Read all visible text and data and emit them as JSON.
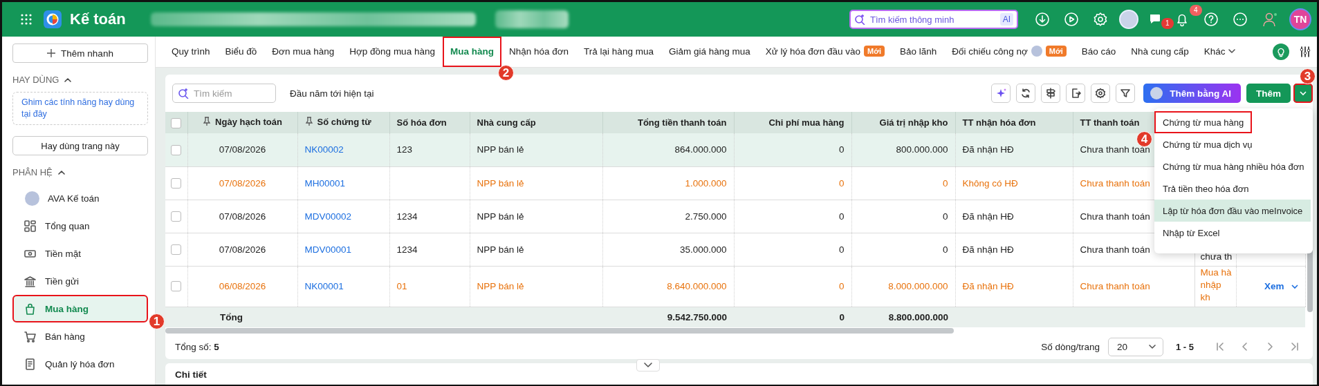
{
  "header": {
    "app_title": "Kế toán",
    "search": {
      "placeholder": "Tìm kiếm thông minh",
      "badge": "AI"
    },
    "message_count": "1",
    "notification_count": "4",
    "user_initials": "TN"
  },
  "sidebar": {
    "quick_add": "Thêm nhanh",
    "favorites": {
      "title": "HAY DÙNG",
      "expanded": true,
      "hint": "Ghim các tính năng hay dùng tại đây",
      "button": "Hay dùng trang này"
    },
    "modules": {
      "title": "PHÂN HỆ",
      "expanded": true,
      "items": [
        {
          "label": "AVA Kế toán",
          "selected": false
        },
        {
          "label": "Tổng quan",
          "selected": false
        },
        {
          "label": "Tiền mặt",
          "selected": false
        },
        {
          "label": "Tiền gửi",
          "selected": false
        },
        {
          "label": "Mua hàng",
          "selected": true,
          "callout": "1"
        },
        {
          "label": "Bán hàng",
          "selected": false
        },
        {
          "label": "Quản lý hóa đơn",
          "selected": false
        }
      ]
    }
  },
  "tabs": [
    {
      "label": "Quy trình",
      "selected": false
    },
    {
      "label": "Biểu đồ",
      "selected": false
    },
    {
      "label": "Đơn mua hàng",
      "selected": false
    },
    {
      "label": "Hợp đồng mua hàng",
      "selected": false
    },
    {
      "label": "Mua hàng",
      "selected": true,
      "callout": "2"
    },
    {
      "label": "Nhận hóa đơn",
      "selected": false
    },
    {
      "label": "Trả lại hàng mua",
      "selected": false
    },
    {
      "label": "Giảm giá hàng mua",
      "selected": false
    },
    {
      "label": "Xử lý hóa đơn đầu vào",
      "selected": false,
      "badge": "Mới"
    },
    {
      "label": "Bảo lãnh",
      "selected": false
    },
    {
      "label": "Đối chiếu công nợ",
      "selected": false,
      "avatar": true,
      "badge": "Mới"
    },
    {
      "label": "Báo cáo",
      "selected": false
    },
    {
      "label": "Nhà cung cấp",
      "selected": false
    },
    {
      "label": "Khác",
      "selected": false,
      "dropdown": true
    }
  ],
  "toolbar": {
    "search": {
      "placeholder": "Tìm kiếm"
    },
    "period": "Đầu năm tới hiện tại",
    "ai_button": "Thêm bằng AI",
    "add_button": "Thêm",
    "add_toggle_callout": "3",
    "add_menu": {
      "expanded": true,
      "items": [
        {
          "label": "Chứng từ mua hàng",
          "hovered": false,
          "callout": "4"
        },
        {
          "label": "Chứng từ mua dịch vụ",
          "hovered": false
        },
        {
          "label": "Chứng từ mua hàng nhiều hóa đơn",
          "hovered": false
        },
        {
          "label": "Trả tiền theo hóa đơn",
          "hovered": false
        },
        {
          "label": "Lập từ hóa đơn đầu vào meInvoice",
          "hovered": true
        },
        {
          "label": "Nhập từ Excel",
          "hovered": false
        }
      ]
    }
  },
  "table": {
    "select_all_checked": false,
    "columns": [
      {
        "label": "Ngày hạch toán",
        "pinned": true
      },
      {
        "label": "Số chứng từ",
        "pinned": true
      },
      {
        "label": "Số hóa đơn",
        "pinned": false
      },
      {
        "label": "Nhà cung cấp",
        "pinned": false
      },
      {
        "label": "Tổng tiền thanh toán",
        "pinned": false
      },
      {
        "label": "Chi phí mua hàng",
        "pinned": false
      },
      {
        "label": "Giá trị nhập kho",
        "pinned": false
      },
      {
        "label": "TT nhận hóa đơn",
        "pinned": false
      },
      {
        "label": "TT thanh toán",
        "pinned": false
      }
    ],
    "rows": [
      {
        "checked": false,
        "selected": true,
        "warning": false,
        "date": "07/08/2026",
        "voucher": "NK00002",
        "invoice": "123",
        "supplier": "NPP bán lẻ",
        "total": "864.000.000",
        "cost": "0",
        "stock_value": "800.000.000",
        "invoice_status": "Đã nhận HĐ",
        "payment_status": "Chưa thanh toán"
      },
      {
        "checked": false,
        "selected": false,
        "warning": true,
        "date": "07/08/2026",
        "voucher": "MH00001",
        "supplier": "NPP bán lẻ",
        "total": "1.000.000",
        "cost": "0",
        "stock_value": "0",
        "invoice_status": "Không có HĐ",
        "payment_status": "Chưa thanh toán"
      },
      {
        "checked": false,
        "selected": false,
        "warning": false,
        "date": "07/08/2026",
        "voucher": "MDV00002",
        "invoice": "1234",
        "supplier": "NPP bán lẻ",
        "total": "2.750.000",
        "cost": "0",
        "stock_value": "0",
        "invoice_status": "Đã nhận HĐ",
        "payment_status": "Chưa thanh toán"
      },
      {
        "checked": false,
        "selected": false,
        "warning": false,
        "date": "07/08/2026",
        "voucher": "MDV00001",
        "invoice": "1234",
        "supplier": "NPP bán lẻ",
        "total": "35.000.000",
        "cost": "0",
        "stock_value": "0",
        "invoice_status": "Đã nhận HĐ",
        "payment_status": "Chưa thanh toán",
        "column_10": "chưa th"
      },
      {
        "checked": false,
        "selected": false,
        "warning": true,
        "date": "06/08/2026",
        "voucher": "NK00001",
        "invoice": "01",
        "supplier": "NPP bán lẻ",
        "total": "8.640.000.000",
        "cost": "0",
        "stock_value": "8.000.000.000",
        "invoice_status": "Đã nhận HĐ",
        "payment_status": "Chưa thanh toán",
        "column_10": "Mua hà nhập kh",
        "action": "Xem"
      }
    ],
    "summary": {
      "label": "Tổng",
      "total": "9.542.750.000",
      "cost": "0",
      "stock_value": "8.800.000.000"
    }
  },
  "footer": {
    "record_count": "Tổng số: **5**",
    "page_size_label": "Số dòng/trang",
    "page_size": "20",
    "range": "1 - 5"
  },
  "detail_panel": {
    "title": "Chi tiết",
    "expanded": false
  }
}
